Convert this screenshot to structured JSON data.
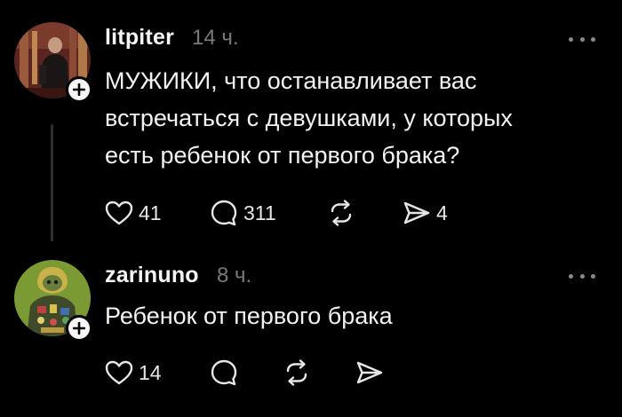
{
  "theme": {
    "background": "#000000",
    "text": "#f2f2f2",
    "muted": "#7a7a7a",
    "thread_line": "#2e2e2e"
  },
  "posts": [
    {
      "username": "litpiter",
      "time": "14 ч.",
      "body_lines": [
        "МУЖИКИ, что останавливает вас",
        "встречаться с девушками, у которых",
        "есть ребенок от первого брака?"
      ],
      "likes": "41",
      "comments": "311",
      "reposts": "",
      "shares": "4"
    },
    {
      "username": "zarinuno",
      "time": "8 ч.",
      "body_lines": [
        "Ребенок от первого брака"
      ],
      "likes": "14",
      "comments": "",
      "reposts": "",
      "shares": ""
    }
  ],
  "icons": {
    "follow": "plus-icon",
    "more": "more-dots-icon",
    "like": "heart-icon",
    "comment": "comment-bubble-icon",
    "repost": "repost-arrows-icon",
    "share": "send-icon"
  }
}
